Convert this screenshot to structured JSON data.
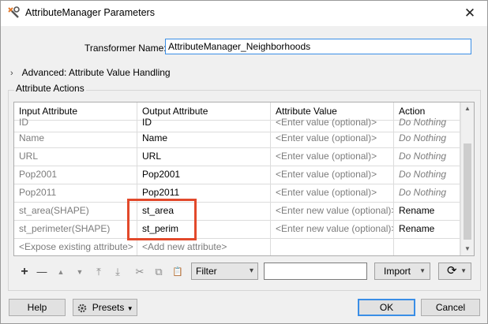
{
  "window": {
    "title": "AttributeManager Parameters"
  },
  "transformer": {
    "label": "Transformer Name:",
    "value": "AttributeManager_Neighborhoods"
  },
  "advanced": {
    "label": "Advanced: Attribute Value Handling"
  },
  "group": {
    "label": "Attribute Actions"
  },
  "table": {
    "headers": [
      "Input Attribute",
      "Output Attribute",
      "Attribute Value",
      "Action"
    ],
    "rows": [
      [
        "ID",
        "ID",
        "<Enter value (optional)>",
        "Do Nothing"
      ],
      [
        "Name",
        "Name",
        "<Enter value (optional)>",
        "Do Nothing"
      ],
      [
        "URL",
        "URL",
        "<Enter value (optional)>",
        "Do Nothing"
      ],
      [
        "Pop2001",
        "Pop2001",
        "<Enter value (optional)>",
        "Do Nothing"
      ],
      [
        "Pop2011",
        "Pop2011",
        "<Enter value (optional)>",
        "Do Nothing"
      ],
      [
        "st_area(SHAPE)",
        "st_area",
        "<Enter new value (optional)>",
        "Rename"
      ],
      [
        "st_perimeter(SHAPE)",
        "st_perim",
        "<Enter new value (optional)>",
        "Rename"
      ],
      [
        "<Expose existing attribute>",
        "<Add new attribute>",
        "",
        ""
      ]
    ]
  },
  "toolbar": {
    "add": "+",
    "remove": "—",
    "move_up": "▲",
    "move_down": "▼",
    "move_top": "⤒",
    "move_bottom": "⤓",
    "cut": "✂",
    "copy": "⧉",
    "paste": "📋",
    "filter_mode": "Filter",
    "filter_value": "",
    "import_label": "Import",
    "refresh_icon": "⟳"
  },
  "footer": {
    "help": "Help",
    "presets": "Presets",
    "ok": "OK",
    "cancel": "Cancel"
  },
  "colors": {
    "accent": "#3a8ee6",
    "highlight": "#e2492b"
  }
}
